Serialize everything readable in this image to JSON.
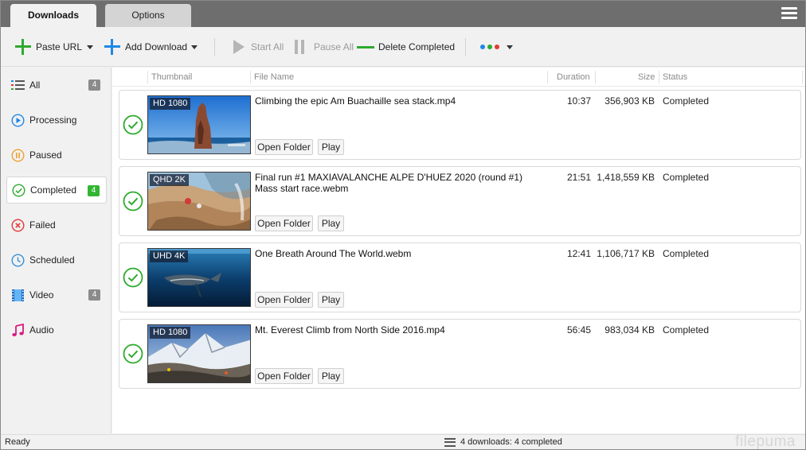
{
  "tabs": [
    {
      "label": "Downloads",
      "active": true
    },
    {
      "label": "Options",
      "active": false
    }
  ],
  "menu_icon": "hamburger-menu-icon",
  "toolbar": {
    "paste_url": "Paste URL",
    "add_download": "Add Download",
    "start_all": "Start All",
    "pause_all": "Pause All",
    "delete_completed": "Delete Completed",
    "accent_green": "#2eaa2e",
    "accent_blue": "#1e88e5",
    "color_dots": [
      "#1e88e5",
      "#2eaa2e",
      "#e53935"
    ]
  },
  "sidebar": {
    "items": [
      {
        "label": "All",
        "icon": "list-icon",
        "count": "4"
      },
      {
        "label": "Processing",
        "icon": "play-circle-icon",
        "count": ""
      },
      {
        "label": "Paused",
        "icon": "pause-circle-icon",
        "count": ""
      },
      {
        "label": "Completed",
        "icon": "check-circle-icon",
        "count": "4",
        "active": true
      },
      {
        "label": "Failed",
        "icon": "x-circle-icon",
        "count": ""
      },
      {
        "label": "Scheduled",
        "icon": "clock-icon",
        "count": ""
      },
      {
        "label": "Video",
        "icon": "film-icon",
        "count": "4"
      },
      {
        "label": "Audio",
        "icon": "music-note-icon",
        "count": ""
      }
    ]
  },
  "columns": {
    "thumbnail": "Thumbnail",
    "file_name": "File Name",
    "duration": "Duration",
    "size": "Size",
    "status": "Status"
  },
  "downloads": [
    {
      "resolution": "HD 1080",
      "file_name": "Climbing the epic Am Buachaille sea stack.mp4",
      "duration": "10:37",
      "size": "356,903 KB",
      "status": "Completed",
      "open_folder": "Open Folder",
      "play": "Play"
    },
    {
      "resolution": "QHD 2K",
      "file_name": "Final run #1 MAXIAVALANCHE ALPE D'HUEZ 2020 (round #1) Mass start race.webm",
      "duration": "21:51",
      "size": "1,418,559 KB",
      "status": "Completed",
      "open_folder": "Open Folder",
      "play": "Play"
    },
    {
      "resolution": "UHD 4K",
      "file_name": "One Breath Around The World.webm",
      "duration": "12:41",
      "size": "1,106,717 KB",
      "status": "Completed",
      "open_folder": "Open Folder",
      "play": "Play"
    },
    {
      "resolution": "HD 1080",
      "file_name": "Mt. Everest Climb from North Side 2016.mp4",
      "duration": "56:45",
      "size": "983,034 KB",
      "status": "Completed",
      "open_folder": "Open Folder",
      "play": "Play"
    }
  ],
  "statusbar": {
    "ready": "Ready",
    "summary": "4 downloads: 4 completed"
  },
  "watermark": "filepuma"
}
